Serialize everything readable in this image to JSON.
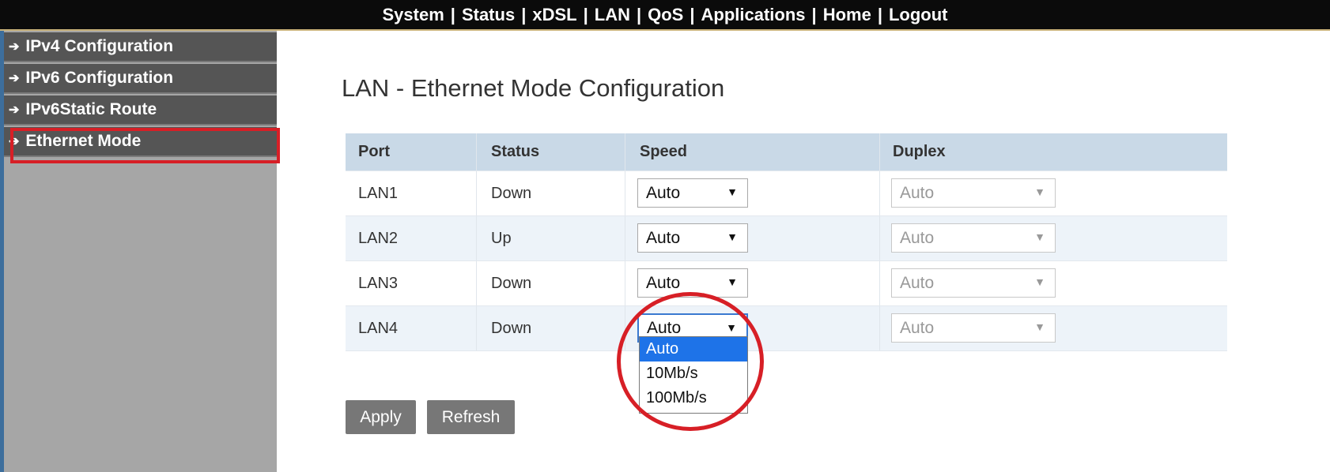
{
  "top_nav": [
    "System",
    "Status",
    "xDSL",
    "LAN",
    "QoS",
    "Applications",
    "Home",
    "Logout"
  ],
  "sidebar": {
    "items": [
      {
        "label": "IPv4 Configuration",
        "icon": "arrow-right-icon"
      },
      {
        "label": "IPv6 Configuration",
        "icon": "arrow-right-icon"
      },
      {
        "label": "IPv6Static Route",
        "icon": "arrow-right-icon"
      },
      {
        "label": "Ethernet Mode",
        "icon": "arrow-right-icon",
        "active": true
      }
    ]
  },
  "main": {
    "title": "LAN - Ethernet Mode Configuration",
    "table": {
      "headers": [
        "Port",
        "Status",
        "Speed",
        "Duplex"
      ],
      "rows": [
        {
          "port": "LAN1",
          "status": "Down",
          "speed": "Auto",
          "duplex": "Auto"
        },
        {
          "port": "LAN2",
          "status": "Up",
          "speed": "Auto",
          "duplex": "Auto"
        },
        {
          "port": "LAN3",
          "status": "Down",
          "speed": "Auto",
          "duplex": "Auto"
        },
        {
          "port": "LAN4",
          "status": "Down",
          "speed": "Auto",
          "duplex": "Auto"
        }
      ]
    },
    "speed_dropdown": {
      "options": [
        "Auto",
        "10Mb/s",
        "100Mb/s"
      ],
      "selected": "Auto"
    },
    "buttons": {
      "apply": "Apply",
      "refresh": "Refresh"
    }
  },
  "colors": {
    "highlight_annotation": "#d71f26",
    "topbar_bg": "#0b0b0b",
    "sidebar_item_bg": "#555555",
    "table_header_bg": "#c9d9e7",
    "button_bg": "#777777",
    "option_selected_bg": "#1e73e8"
  }
}
